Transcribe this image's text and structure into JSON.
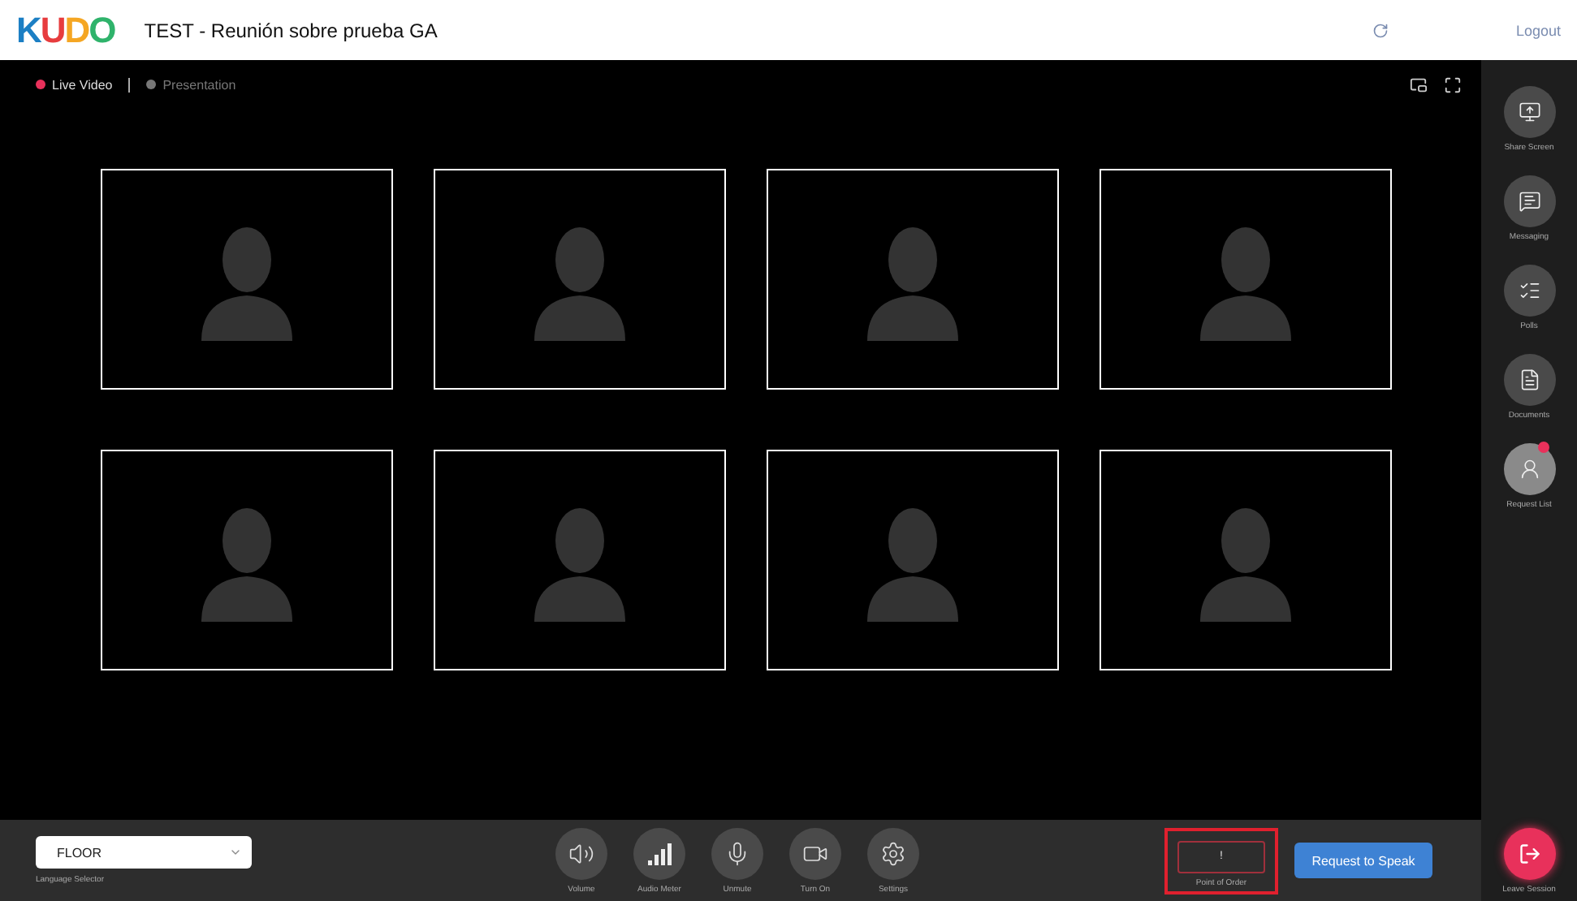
{
  "header": {
    "logo": "KUDO",
    "title": "TEST - Reunión sobre prueba GA",
    "logout": "Logout"
  },
  "view_tabs": [
    {
      "label": "Live Video",
      "selected": true
    },
    {
      "label": "Presentation",
      "selected": false
    }
  ],
  "video_tiles": [
    {
      "kind": "avatar"
    },
    {
      "kind": "avatar"
    },
    {
      "kind": "avatar"
    },
    {
      "kind": "avatar"
    },
    {
      "kind": "avatar"
    },
    {
      "kind": "avatar"
    },
    {
      "kind": "avatar"
    },
    {
      "kind": "avatar"
    }
  ],
  "sidebar": [
    {
      "kind": "share",
      "label": "Share Screen",
      "badge": false
    },
    {
      "kind": "messaging",
      "label": "Messaging",
      "badge": false
    },
    {
      "kind": "polls",
      "label": "Polls",
      "badge": false
    },
    {
      "kind": "documents",
      "label": "Documents",
      "badge": false
    },
    {
      "kind": "request",
      "label": "Request List",
      "badge": true
    }
  ],
  "language": {
    "value": "FLOOR",
    "label": "Language Selector"
  },
  "controls": [
    {
      "kind": "volume",
      "label": "Volume"
    },
    {
      "kind": "meter",
      "label": "Audio Meter"
    },
    {
      "kind": "mic",
      "label": "Unmute"
    },
    {
      "kind": "camera",
      "label": "Turn On"
    },
    {
      "kind": "settings",
      "label": "Settings"
    }
  ],
  "point_of_order": {
    "value": "!",
    "label": "Point of Order",
    "highlighted": true
  },
  "request_button": "Request to Speak",
  "leave": {
    "label": "Leave Session"
  }
}
